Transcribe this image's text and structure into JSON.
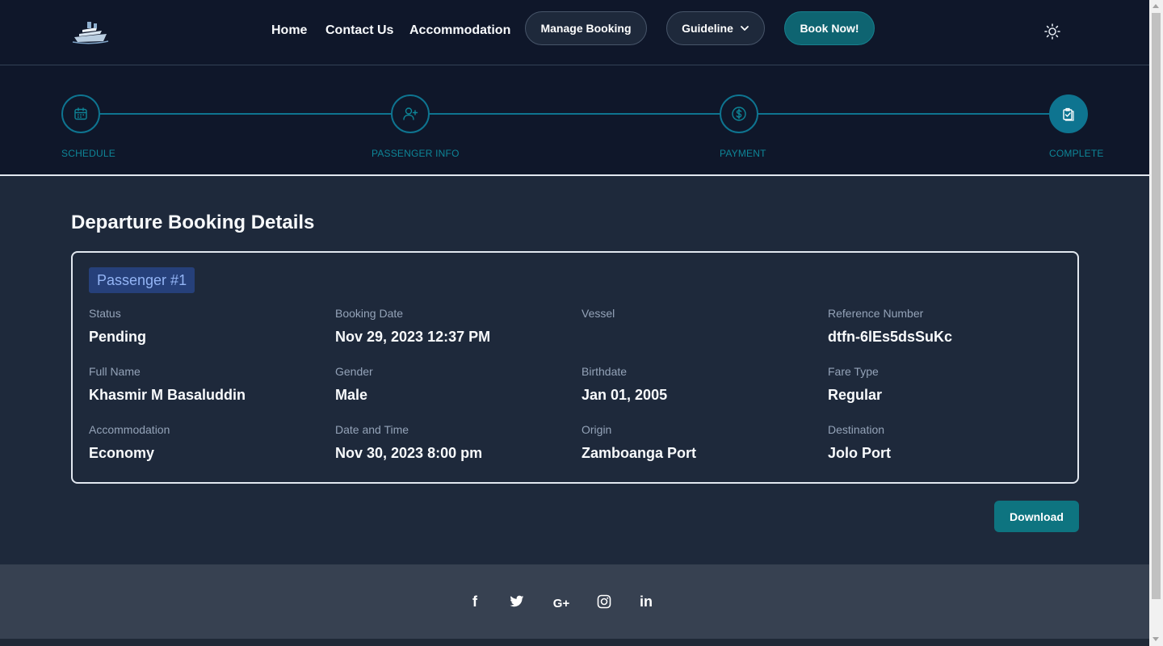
{
  "nav": {
    "home": "Home",
    "contact": "Contact Us",
    "accommodation": "Accommodation",
    "manage_booking": "Manage Booking",
    "guideline": "Guideline",
    "book_now": "Book Now!"
  },
  "stepper": {
    "steps": [
      {
        "label": "SCHEDULE",
        "icon": "calendar-icon"
      },
      {
        "label": "PASSENGER INFO",
        "icon": "user-plus-icon"
      },
      {
        "label": "PAYMENT",
        "icon": "dollar-icon"
      },
      {
        "label": "COMPLETE",
        "icon": "clipboard-check-icon"
      }
    ],
    "active_step": "COMPLETE"
  },
  "booking": {
    "title": "Departure Booking Details",
    "passenger_label": "Passenger #1",
    "fields": [
      {
        "label": "Status",
        "value": "Pending"
      },
      {
        "label": "Booking Date",
        "value": "Nov 29, 2023 12:37 PM"
      },
      {
        "label": "Vessel",
        "value": ""
      },
      {
        "label": "Reference Number",
        "value": "dtfn-6lEs5dsSuKc"
      },
      {
        "label": "Full Name",
        "value": "Khasmir M Basaluddin"
      },
      {
        "label": "Gender",
        "value": "Male"
      },
      {
        "label": "Birthdate",
        "value": "Jan 01, 2005"
      },
      {
        "label": "Fare Type",
        "value": "Regular"
      },
      {
        "label": "Accommodation",
        "value": "Economy"
      },
      {
        "label": "Date and Time",
        "value": "Nov 30, 2023 8:00 pm"
      },
      {
        "label": "Origin",
        "value": "Zamboanga Port"
      },
      {
        "label": "Destination",
        "value": "Jolo Port"
      }
    ],
    "download": "Download"
  },
  "footer": {
    "social": [
      "facebook-icon",
      "twitter-icon",
      "google-plus-icon",
      "instagram-icon",
      "linkedin-icon"
    ],
    "google_plus_text": "G+",
    "linkedin_text": "in",
    "facebook_text": "f"
  },
  "colors": {
    "nav_bg": "#0f172a",
    "page_bg": "#1e293b",
    "accent": "#0e7490",
    "footer_bg": "#374151"
  }
}
